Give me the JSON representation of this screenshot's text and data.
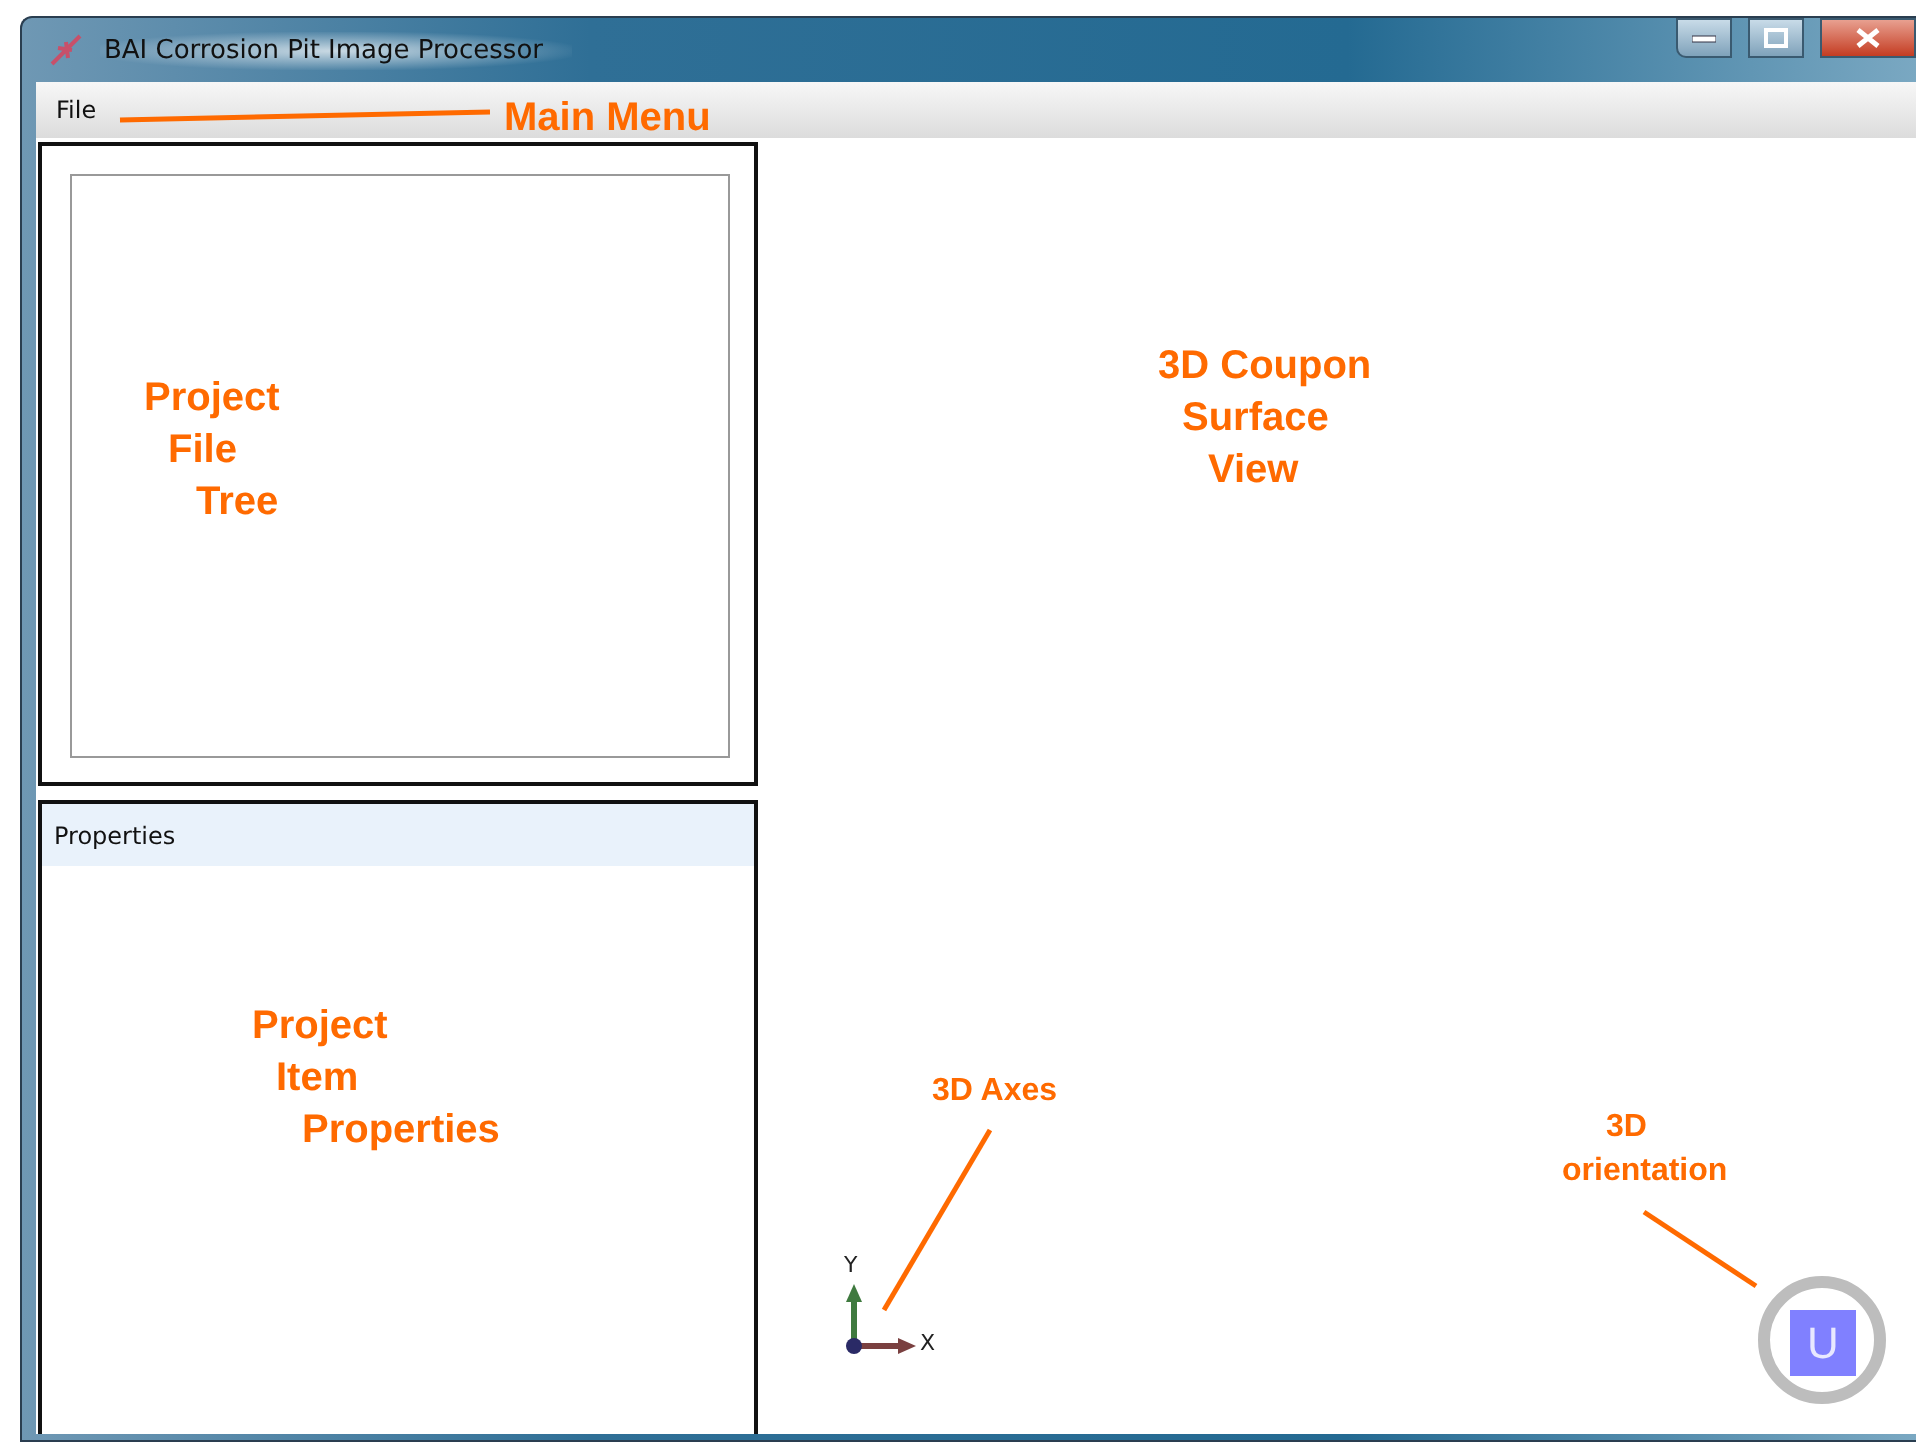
{
  "window": {
    "title": "BAI Corrosion Pit Image Processor"
  },
  "menu": [
    "File"
  ],
  "properties_panel": {
    "title": "Properties"
  },
  "axes": {
    "labels": [
      "Y",
      "X"
    ]
  },
  "orientation_cube": {
    "face": "U"
  },
  "annotations": [
    {
      "lines": [
        "Main Menu"
      ]
    },
    {
      "lines": [
        "Project",
        "File",
        "Tree"
      ]
    },
    {
      "lines": [
        "3D Coupon",
        "Surface",
        "View"
      ]
    },
    {
      "lines": [
        "Project",
        "Item",
        "Properties"
      ]
    },
    {
      "lines": [
        "3D Axes"
      ]
    },
    {
      "lines": [
        "3D",
        "orientation"
      ]
    }
  ]
}
